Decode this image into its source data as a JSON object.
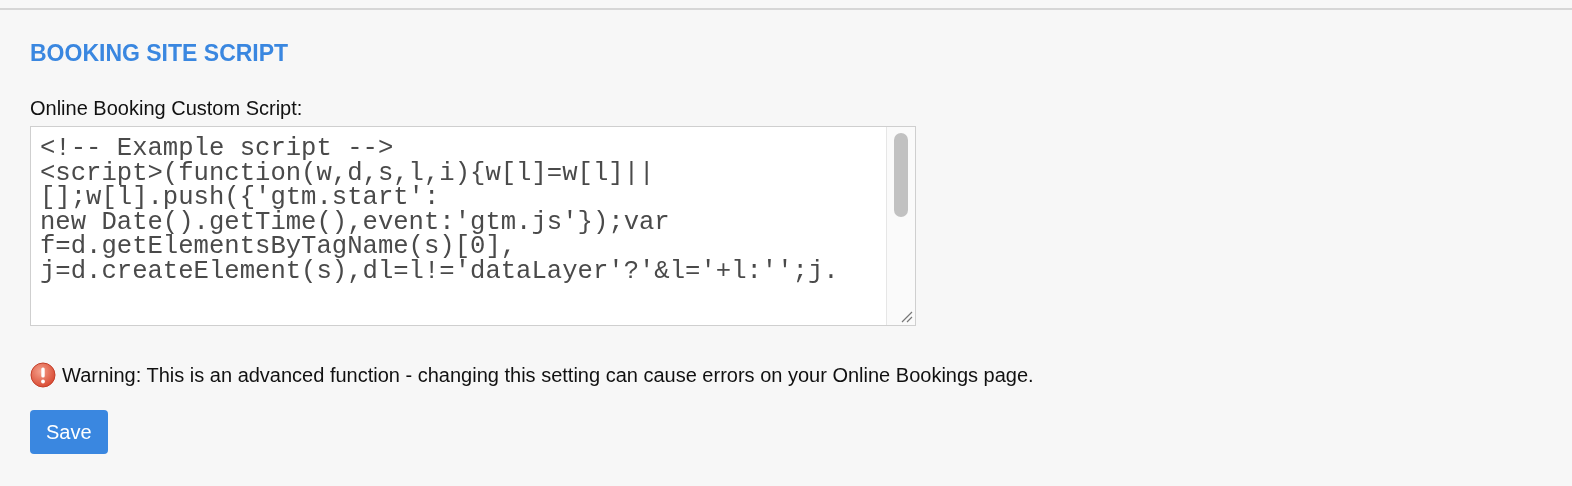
{
  "section": {
    "title": "BOOKING SITE SCRIPT"
  },
  "script_field": {
    "label": "Online Booking Custom Script:",
    "lines": [
      "<!-- Example script -->",
      "<script>(function(w,d,s,l,i){w[l]=w[l]||",
      "[];w[l].push({'gtm.start':",
      "new Date().getTime(),event:'gtm.js'});var",
      "f=d.getElementsByTagName(s)[0],",
      "j=d.createElement(s),dl=l!='dataLayer'?'&l='+l:'';j."
    ]
  },
  "warning": {
    "text": "Warning: This is an advanced function - changing this setting can cause errors on your Online Bookings page."
  },
  "buttons": [
    {
      "label": "Save"
    }
  ]
}
